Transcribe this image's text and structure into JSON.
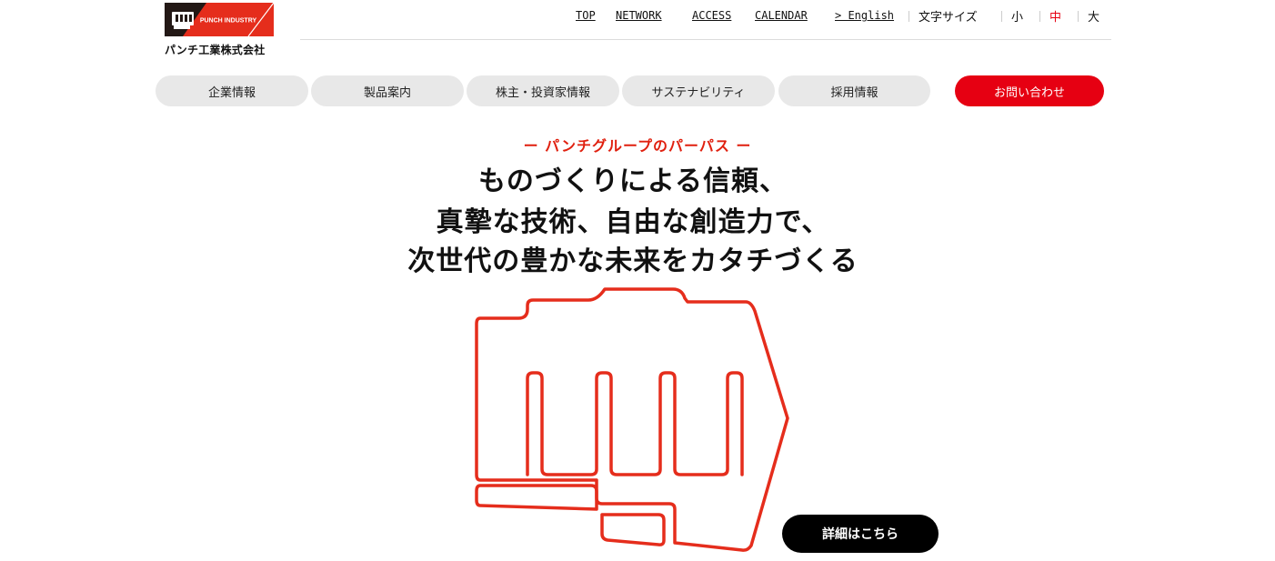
{
  "logo": {
    "box_text": "PUNCH INDUSTRY",
    "caption": "パンチ工業株式会社",
    "brand_red": "#e52d1c",
    "brand_black": "#231815"
  },
  "topnav": {
    "links": [
      "TOP",
      "NETWORK",
      "ACCESS",
      "CALENDAR",
      "> English"
    ]
  },
  "fontsize": {
    "label": "文字サイズ",
    "small": "小",
    "medium": "中",
    "large": "大",
    "selected": "中"
  },
  "mainnav": {
    "items": [
      "企業情報",
      "製品案内",
      "株主・投資家情報",
      "サステナビリティ",
      "採用情報"
    ],
    "contact": "お問い合わせ"
  },
  "hero": {
    "label": "ー パンチグループのパーパス ー",
    "lines": [
      "ものづくりによる信頼、",
      "真摯な技術、自由な創造力で、",
      "次世代の豊かな未来をカタチづくる"
    ],
    "detail_button": "詳細はこちら"
  },
  "colors": {
    "accent": "#e60012",
    "nav_bg": "#e8e8e8",
    "button_dark": "#000000"
  }
}
